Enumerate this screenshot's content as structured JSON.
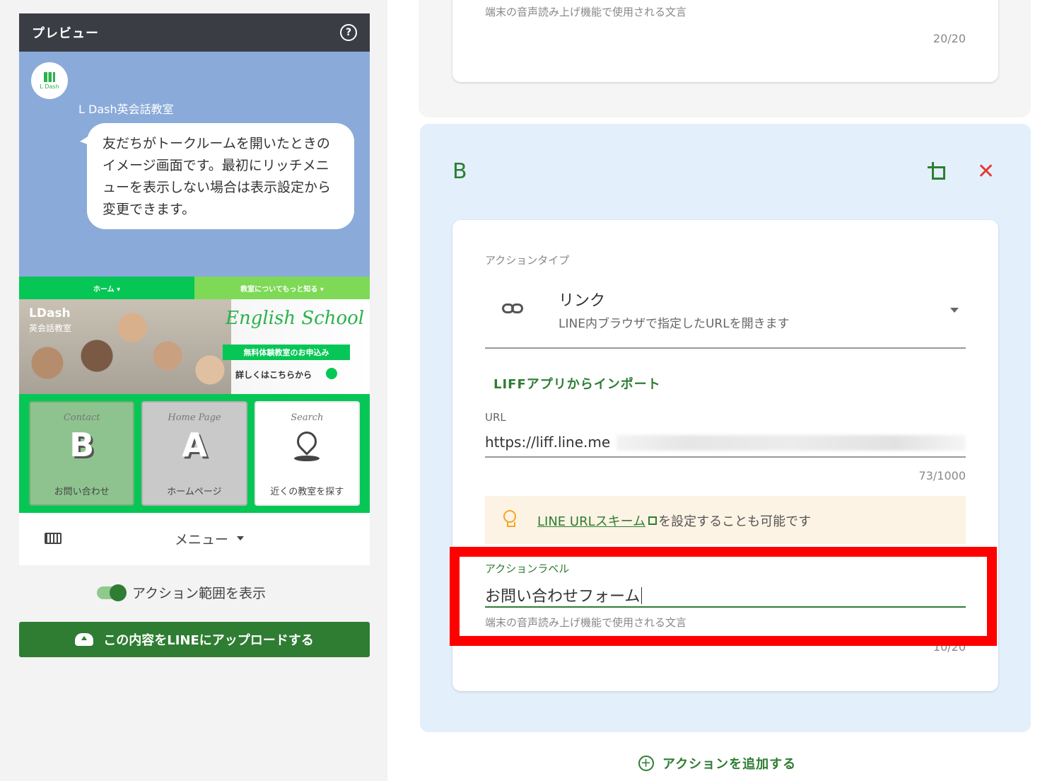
{
  "preview": {
    "title": "プレビュー",
    "help_icon": "?",
    "bot_name": "L Dash英会話教室",
    "avatar_text": "L Dash",
    "bubble_text": "友だちがトークルームを開いたときのイメージ画面です。最初にリッチメニューを表示しない場合は表示設定から変更できます。",
    "rich_tabs": [
      "ホーム ▾",
      "教室についてもっと知る ▾"
    ],
    "banner": {
      "logo": "LDash",
      "logo_sub": "英会話教室",
      "script_title": "English School",
      "pill": "無料体験教室のお申込み",
      "more": "詳しくはこちらから"
    },
    "tiles": [
      {
        "script": "Contact",
        "letter": "B",
        "label": "お問い合わせ"
      },
      {
        "script": "Home Page",
        "letter": "A",
        "label": "ホームページ"
      },
      {
        "script": "Search",
        "letter": "",
        "label": "近くの教室を探す"
      }
    ],
    "menu_label": "メニュー",
    "toggle_label": "アクション範囲を表示",
    "upload_label": "この内容をLINEにアップロードする"
  },
  "prev_card": {
    "hint": "端末の音声読み上げ機能で使用される文言",
    "count": "20/20"
  },
  "action_b": {
    "letter": "B",
    "close": "✕",
    "action_type_caption": "アクションタイプ",
    "action_type_title": "リンク",
    "action_type_sub": "LINE内ブラウザで指定したURLを開きます",
    "import_link": "LIFFアプリからインポート",
    "url_label": "URL",
    "url_value": "https://liff.line.me",
    "url_count": "73/1000",
    "hint_link": "LINE URLスキーム",
    "hint_rest": "を設定することも可能です",
    "label_caption": "アクションラベル",
    "label_value": "お問い合わせフォーム",
    "label_hint": "端末の音声読み上げ機能で使用される文言",
    "label_count": "10/20"
  },
  "add_action": {
    "plus": "+",
    "label": "アクションを追加する"
  },
  "colors": {
    "accent_green": "#2e7d32",
    "line_green": "#06c755",
    "highlight_red": "#ff0000",
    "panel_blue": "#e3f0fc"
  }
}
